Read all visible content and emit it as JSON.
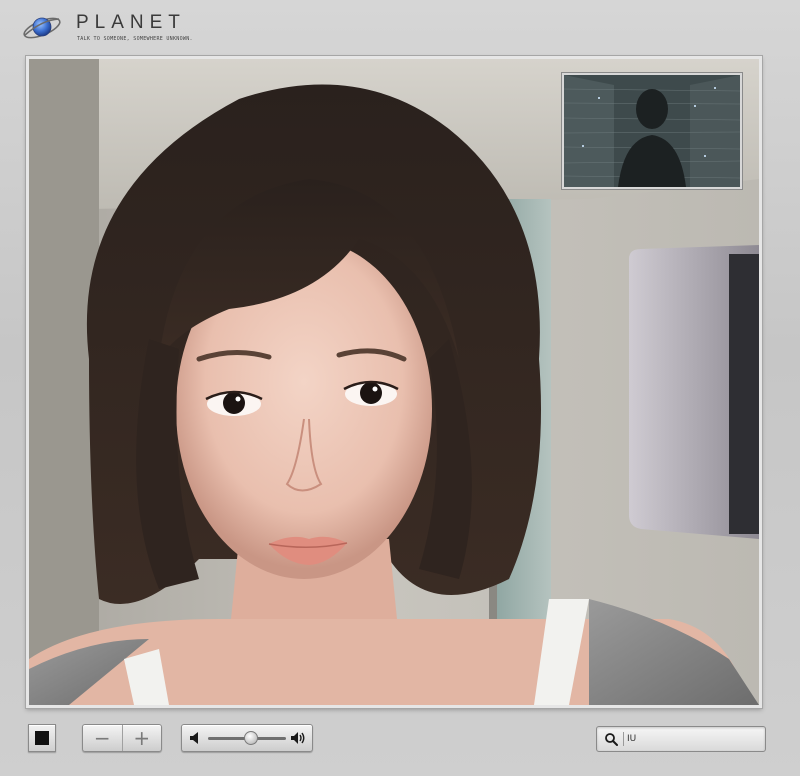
{
  "app": {
    "brand": "PLANET",
    "tagline": "TALK TO SOMEONE, SOMEWHERE UNKNOWN."
  },
  "controls": {
    "zoom_out": "−",
    "zoom_in": "+",
    "volume_level": 0.55
  },
  "search": {
    "value": "IU"
  },
  "icons": {
    "logo": "planet-ring-icon",
    "stop": "stop-icon",
    "volume_low": "speaker-low-icon",
    "volume_high": "speaker-high-icon",
    "search": "magnifier-icon"
  },
  "colors": {
    "chrome": "#c9c9c9",
    "text": "#3a3a3a",
    "accent": "#4a7fd6"
  }
}
